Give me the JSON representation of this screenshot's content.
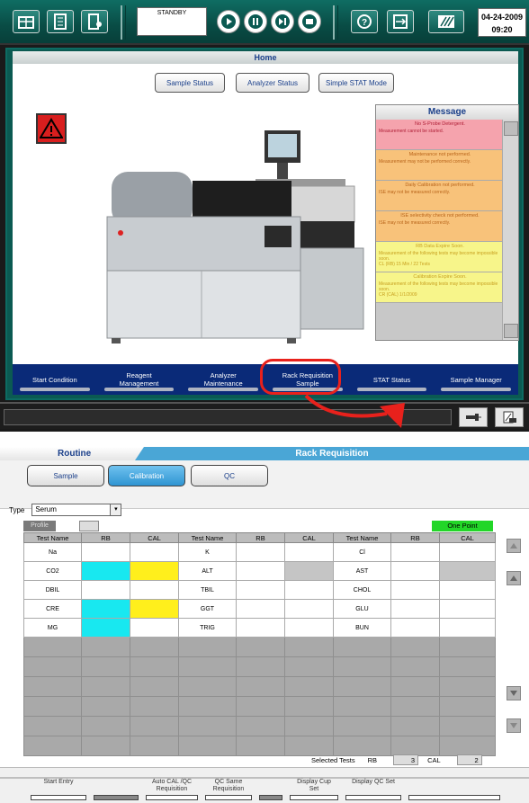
{
  "toolbar": {
    "status": "STANDBY",
    "date": "04-24-2009",
    "time": "09:20"
  },
  "home": {
    "title": "Home",
    "tabs": [
      "Sample Status",
      "Analyzer Status",
      "Simple STAT Mode"
    ],
    "message_title": "Message",
    "messages": [
      {
        "title": "No S-Probe Detergent.",
        "detail": "Measurement cannot be started.",
        "level": "red"
      },
      {
        "title": "Maintenance not performed.",
        "detail": "Measurement may not be performed correctly.",
        "level": "orange"
      },
      {
        "title": "Daily Calibration not performed.",
        "detail": "ISE may not be measured correctly.",
        "level": "orange"
      },
      {
        "title": "ISE selectivity check not performed.",
        "detail": "ISE may not be measured correctly.",
        "level": "orange"
      },
      {
        "title": "RB Data Expire Soon.",
        "detail": "Measurement of the following tests may become impossible soon.",
        "extra": "CL (RB) 15 Min / 22 Tests",
        "level": "yellow"
      },
      {
        "title": "Calibration Expire Soon.",
        "detail": "Measurement of the following tests may become impossible soon.",
        "extra": "CR (CAL) 1/1/2009",
        "level": "yellow"
      }
    ],
    "nav": [
      {
        "l1": "Start Condition",
        "l2": ""
      },
      {
        "l1": "Reagent",
        "l2": "Management"
      },
      {
        "l1": "Analyzer",
        "l2": "Maintenance"
      },
      {
        "l1": "Rack Requisition",
        "l2": "Sample"
      },
      {
        "l1": "STAT Status",
        "l2": ""
      },
      {
        "l1": "Sample Manager",
        "l2": ""
      }
    ]
  },
  "rack": {
    "left_title": "Routine",
    "right_title": "Rack Requisition",
    "tabs": [
      "Sample",
      "Calibration",
      "QC"
    ],
    "type_label": "Type",
    "type_value": "Serum",
    "profile_label": "Profile",
    "one_point": "One Point",
    "columns": [
      "Test Name",
      "RB",
      "CAL",
      "Test Name",
      "RB",
      "CAL",
      "Test Name",
      "RB",
      "CAL"
    ],
    "rows": [
      [
        {
          "t": "Na"
        },
        {
          "t": "",
          "c": ""
        },
        {
          "t": "",
          "c": ""
        },
        {
          "t": "K"
        },
        {
          "t": "",
          "c": ""
        },
        {
          "t": "",
          "c": ""
        },
        {
          "t": "Cl"
        },
        {
          "t": "",
          "c": ""
        },
        {
          "t": "",
          "c": ""
        }
      ],
      [
        {
          "t": "CO2"
        },
        {
          "t": "",
          "c": "cyan"
        },
        {
          "t": "",
          "c": "yellow"
        },
        {
          "t": "ALT"
        },
        {
          "t": "",
          "c": ""
        },
        {
          "t": "",
          "c": "gray"
        },
        {
          "t": "AST"
        },
        {
          "t": "",
          "c": ""
        },
        {
          "t": "",
          "c": "gray"
        }
      ],
      [
        {
          "t": "DBIL"
        },
        {
          "t": "",
          "c": ""
        },
        {
          "t": "",
          "c": ""
        },
        {
          "t": "TBIL"
        },
        {
          "t": "",
          "c": ""
        },
        {
          "t": "",
          "c": ""
        },
        {
          "t": "CHOL"
        },
        {
          "t": "",
          "c": ""
        },
        {
          "t": "",
          "c": ""
        }
      ],
      [
        {
          "t": "CRE"
        },
        {
          "t": "",
          "c": "cyan"
        },
        {
          "t": "",
          "c": "yellow"
        },
        {
          "t": "GGT"
        },
        {
          "t": "",
          "c": ""
        },
        {
          "t": "",
          "c": ""
        },
        {
          "t": "GLU"
        },
        {
          "t": "",
          "c": ""
        },
        {
          "t": "",
          "c": ""
        }
      ],
      [
        {
          "t": "MG"
        },
        {
          "t": "",
          "c": "cyan"
        },
        {
          "t": "",
          "c": ""
        },
        {
          "t": "TRIG"
        },
        {
          "t": "",
          "c": ""
        },
        {
          "t": "",
          "c": ""
        },
        {
          "t": "BUN"
        },
        {
          "t": "",
          "c": ""
        },
        {
          "t": "",
          "c": ""
        }
      ]
    ],
    "selected_label": "Selected Tests",
    "rb_label": "RB",
    "rb_value": "3",
    "cal_label": "CAL",
    "cal_value": "2",
    "footer": [
      {
        "l1": "",
        "l2": "Start Entry"
      },
      {
        "l1": "",
        "l2": ""
      },
      {
        "l1": "Auto CAL /QC",
        "l2": "Requisition"
      },
      {
        "l1": "QC Same",
        "l2": "Requisition"
      },
      {
        "l1": "",
        "l2": ""
      },
      {
        "l1": "Display Cup",
        "l2": "Set"
      },
      {
        "l1": "",
        "l2": "Display QC Set"
      },
      {
        "l1": "",
        "l2": ""
      }
    ]
  }
}
